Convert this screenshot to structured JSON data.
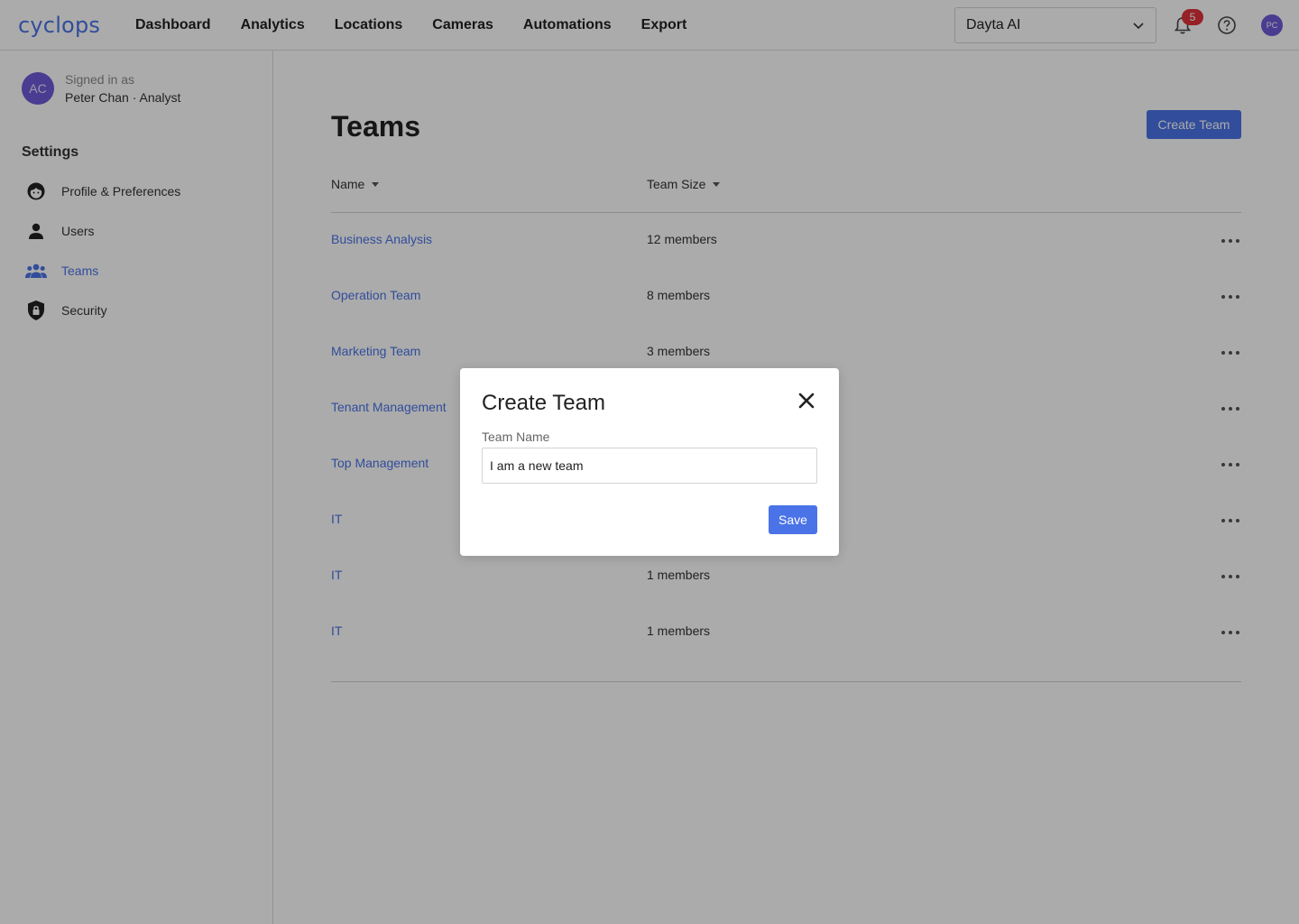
{
  "header": {
    "logo": "cyclops",
    "nav": [
      "Dashboard",
      "Analytics",
      "Locations",
      "Cameras",
      "Automations",
      "Export"
    ],
    "org_select": "Dayta AI",
    "notification_count": "5",
    "user_initials": "PC"
  },
  "sidebar": {
    "avatar_initials": "AC",
    "signed_in_label": "Signed in as",
    "signed_in_name": "Peter Chan · Analyst",
    "section_title": "Settings",
    "items": [
      {
        "label": "Profile & Preferences",
        "icon": "face-icon",
        "active": false
      },
      {
        "label": "Users",
        "icon": "user-icon",
        "active": false
      },
      {
        "label": "Teams",
        "icon": "group-icon",
        "active": true
      },
      {
        "label": "Security",
        "icon": "shield-lock-icon",
        "active": false
      }
    ]
  },
  "main": {
    "title": "Teams",
    "create_button": "Create Team",
    "columns": {
      "name": "Name",
      "size": "Team Size"
    },
    "rows": [
      {
        "name": "Business Analysis",
        "size": "12 members"
      },
      {
        "name": "Operation Team",
        "size": "8 members"
      },
      {
        "name": "Marketing Team",
        "size": "3 members"
      },
      {
        "name": "Tenant Management",
        "size": ""
      },
      {
        "name": "Top Management",
        "size": ""
      },
      {
        "name": "IT",
        "size": ""
      },
      {
        "name": "IT",
        "size": "1 members"
      },
      {
        "name": "IT",
        "size": "1 members"
      }
    ]
  },
  "modal": {
    "title": "Create Team",
    "field_label": "Team Name",
    "field_value": "I am a new team",
    "save_label": "Save"
  },
  "colors": {
    "accent": "#4a73e8",
    "avatar": "#6e5ad8",
    "badge": "#e0323a",
    "overlay": "rgba(0,0,0,0.33)"
  }
}
